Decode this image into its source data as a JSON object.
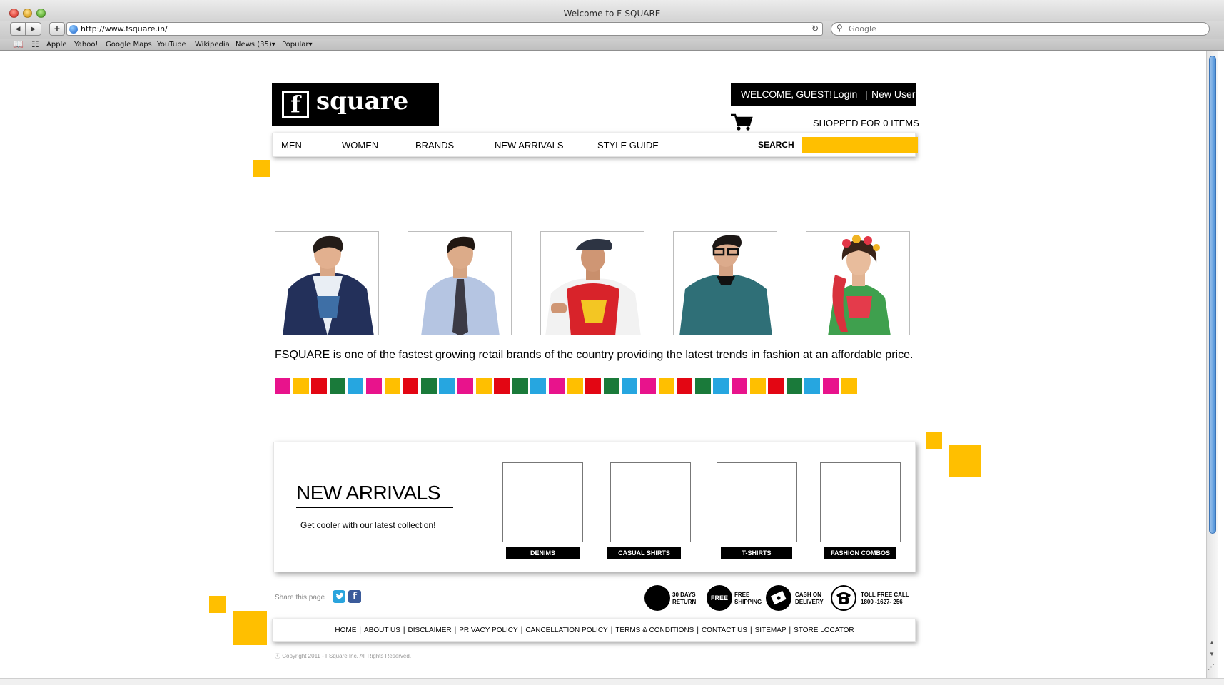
{
  "browser": {
    "window_title": "Welcome to F-SQUARE",
    "url": "http://www.fsquare.in/",
    "search_placeholder": "Google",
    "bookmarks": [
      "Apple",
      "Yahoo!",
      "Google Maps",
      "YouTube",
      "Wikipedia",
      "News (35)▾",
      "Popular▾"
    ]
  },
  "header": {
    "logo_letter": "f",
    "logo_word": "square",
    "welcome": "WELCOME, GUEST!",
    "login": "Login",
    "separator": "|",
    "new_user": "New User",
    "cart_status": "SHOPPED FOR 0 ITEMS"
  },
  "nav": {
    "items": [
      "MEN",
      "WOMEN",
      "BRANDS",
      "NEW ARRIVALS",
      "STYLE GUIDE"
    ],
    "search_label": "SEARCH"
  },
  "hero": {
    "tagline": "FSQUARE is one of the fastest growing retail brands of the country providing the latest trends in fashion at an affordable price."
  },
  "colors": {
    "accent": "#ffbf00",
    "swatches": [
      "#e8138c",
      "#ffbf00",
      "#e30613",
      "#1a7a3a",
      "#26a6e0"
    ]
  },
  "new_arrivals": {
    "title": "NEW ARRIVALS",
    "subtitle": "Get cooler with our latest collection!",
    "categories": [
      "DENIMS",
      "CASUAL SHIRTS",
      "T-SHIRTS",
      "FASHION COMBOS"
    ]
  },
  "share": {
    "label": "Share this page",
    "facebook_glyph": "f"
  },
  "features": [
    {
      "icon_text": "",
      "line1": "30 DAYS",
      "line2": "RETURN"
    },
    {
      "icon_text": "FREE",
      "line1": "FREE",
      "line2": "SHIPPING"
    },
    {
      "icon_text": "",
      "line1": "CASH ON",
      "line2": "DELIVERY"
    },
    {
      "icon_text": "",
      "line1": "TOLL FREE CALL",
      "line2": "1800 -1627- 256"
    }
  ],
  "footer": {
    "links": [
      "HOME",
      "ABOUT US",
      "DISCLAIMER",
      "PRIVACY POLICY",
      "CANCELLATION POLICY",
      "TERMS & CONDITIONS",
      "CONTACT US",
      "SITEMAP",
      "STORE LOCATOR"
    ],
    "separator": "|",
    "copyright": "ⓒ Copyright 2011 - FSquare Inc. All Rights Reserved."
  }
}
